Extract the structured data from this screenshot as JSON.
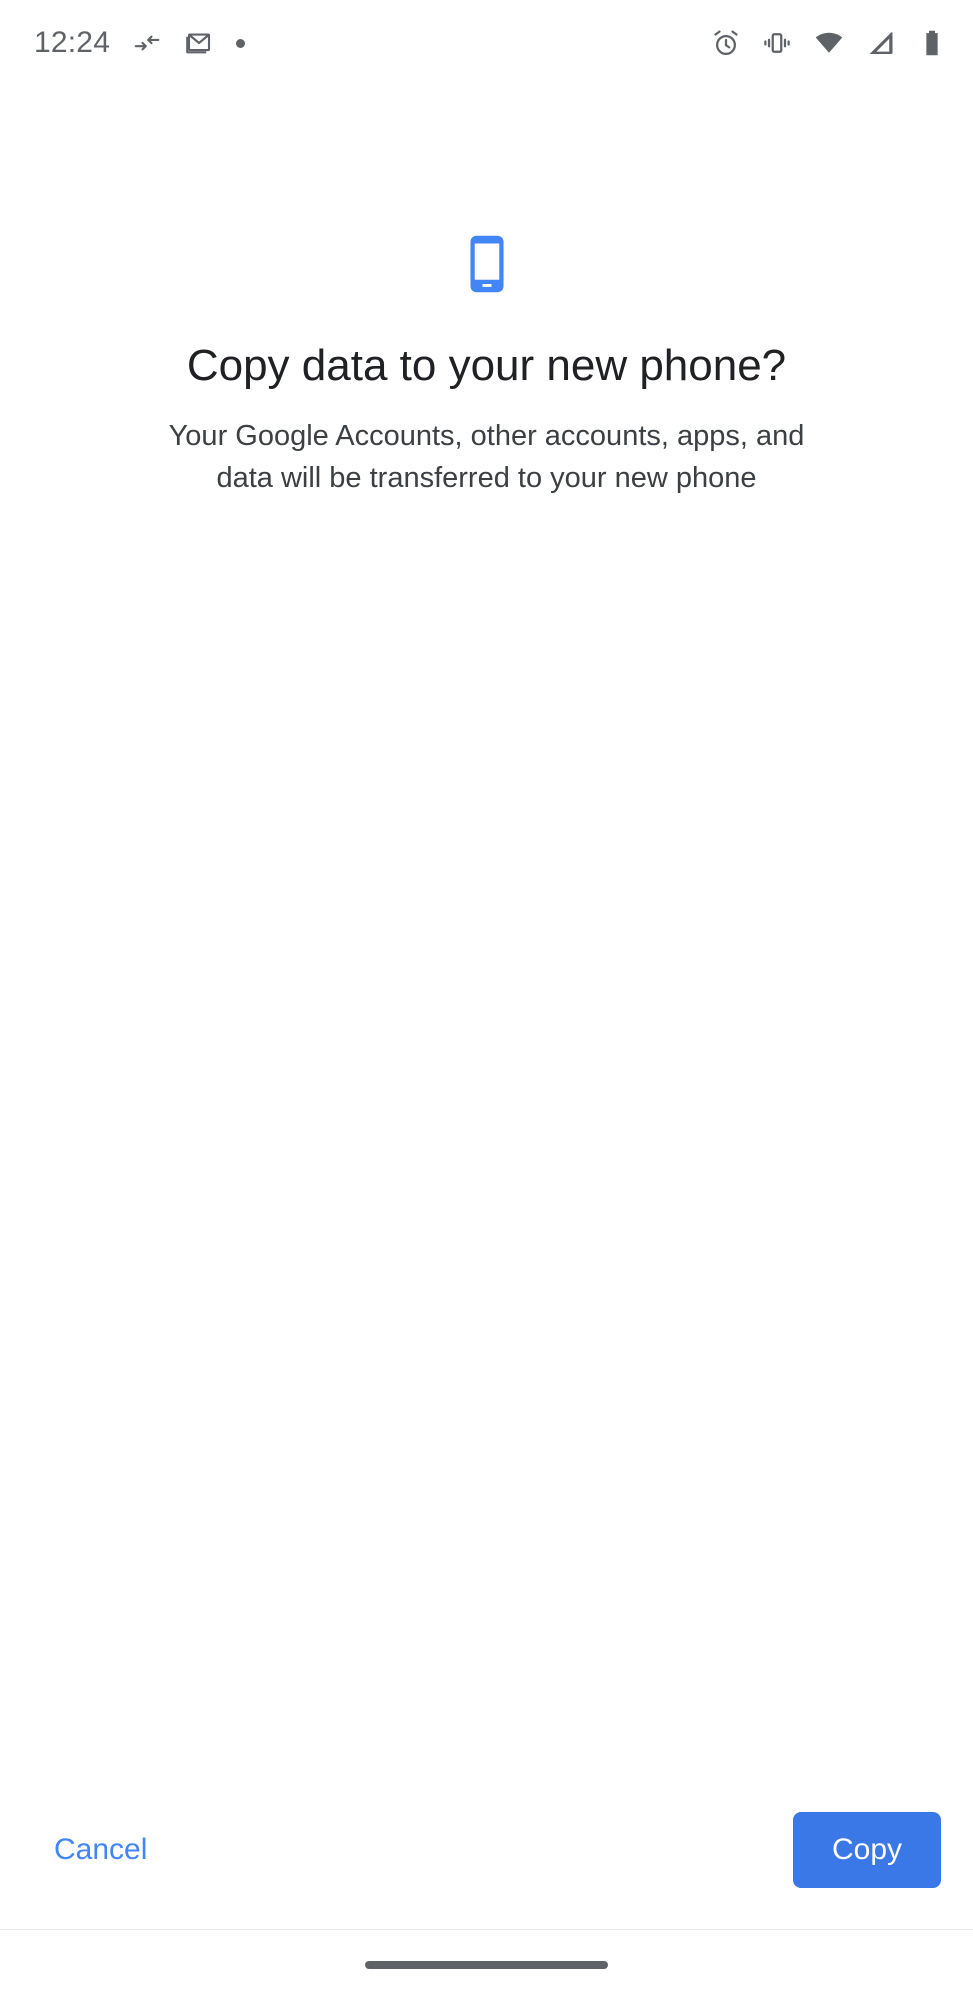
{
  "status_bar": {
    "clock": "12:24",
    "left_icons": [
      {
        "name": "data-transfer-arrows-icon",
        "label": "Data transfer"
      },
      {
        "name": "gmail-icon",
        "label": "Gmail"
      },
      {
        "name": "notification-dot-icon",
        "label": "Notification"
      }
    ],
    "right_icons": [
      {
        "name": "alarm-icon",
        "label": "Alarm set"
      },
      {
        "name": "vibrate-icon",
        "label": "Ringer vibrate"
      },
      {
        "name": "wifi-icon",
        "label": "Wi-Fi"
      },
      {
        "name": "cellular-signal-icon",
        "label": "Mobile signal"
      },
      {
        "name": "battery-icon",
        "label": "Battery full"
      }
    ]
  },
  "hero": {
    "icon": "smartphone-icon",
    "icon_color": "#4285f4"
  },
  "main": {
    "title": "Copy data to your new phone?",
    "subtitle": "Your Google Accounts, other accounts, apps, and data will be transferred to your new phone"
  },
  "footer": {
    "cancel_label": "Cancel",
    "copy_label": "Copy",
    "cancel_color": "#4285f4",
    "copy_bg_color": "#3b78e7",
    "copy_text_color": "#ffffff"
  },
  "nav_bar": {
    "home_indicator": "home-gesture-bar"
  }
}
